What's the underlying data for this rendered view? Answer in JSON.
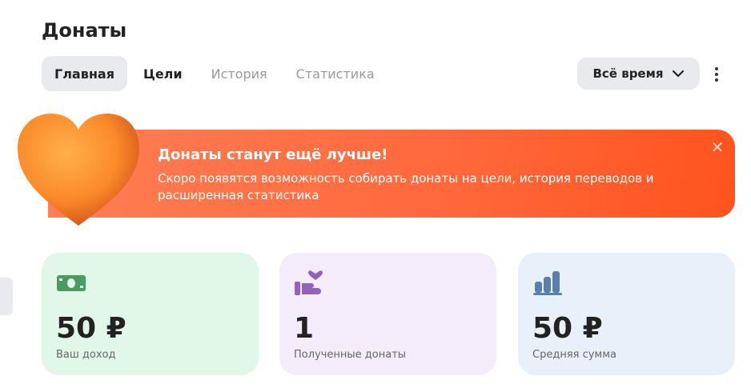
{
  "header": {
    "title": "Донаты"
  },
  "tabs": [
    {
      "label": "Главная"
    },
    {
      "label": "Цели"
    },
    {
      "label": "История"
    },
    {
      "label": "Статистика"
    }
  ],
  "period": {
    "label": "Всё время"
  },
  "banner": {
    "title": "Донаты станут ещё лучше!",
    "text": "Скоро появятся возможность собирать донаты на цели, история переводов и расширенная статистика",
    "close": "✕"
  },
  "cards": [
    {
      "value": "50 ₽",
      "label": "Ваш доход",
      "color": "#e1f8e9",
      "icon_color": "#4a9a64"
    },
    {
      "value": "1",
      "label": "Полученные донаты",
      "color": "#f4ecfa",
      "icon_color": "#9263b8"
    },
    {
      "value": "50 ₽",
      "label": "Средняя сумма",
      "color": "#e8f0fa",
      "icon_color": "#5b7fa6"
    }
  ]
}
